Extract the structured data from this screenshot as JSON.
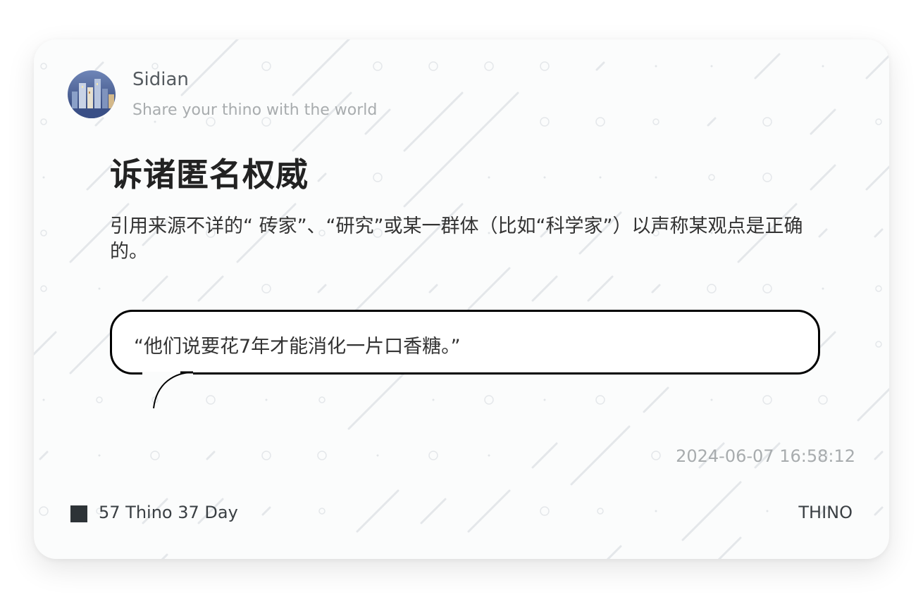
{
  "profile": {
    "name": "Sidian",
    "tagline": "Share your thino with the world",
    "avatar_icon": "cityscape-avatar-icon"
  },
  "note": {
    "title": "诉诸匿名权威",
    "body": "引用来源不详的“ 砖家”、“研究”或某一群体（比如“科学家”）以声称某观点是正确的。",
    "quote": "“他们说要花7年才能消化一片口香糖。”",
    "timestamp": "2024-06-07 16:58:12"
  },
  "footer": {
    "stats": "57 Thino 37 Day",
    "brand": "THINO"
  },
  "colors": {
    "card_background": "#fbfcfc",
    "text_dark": "#222222",
    "text_muted": "#a8acae",
    "stats_square": "#2d3337"
  }
}
